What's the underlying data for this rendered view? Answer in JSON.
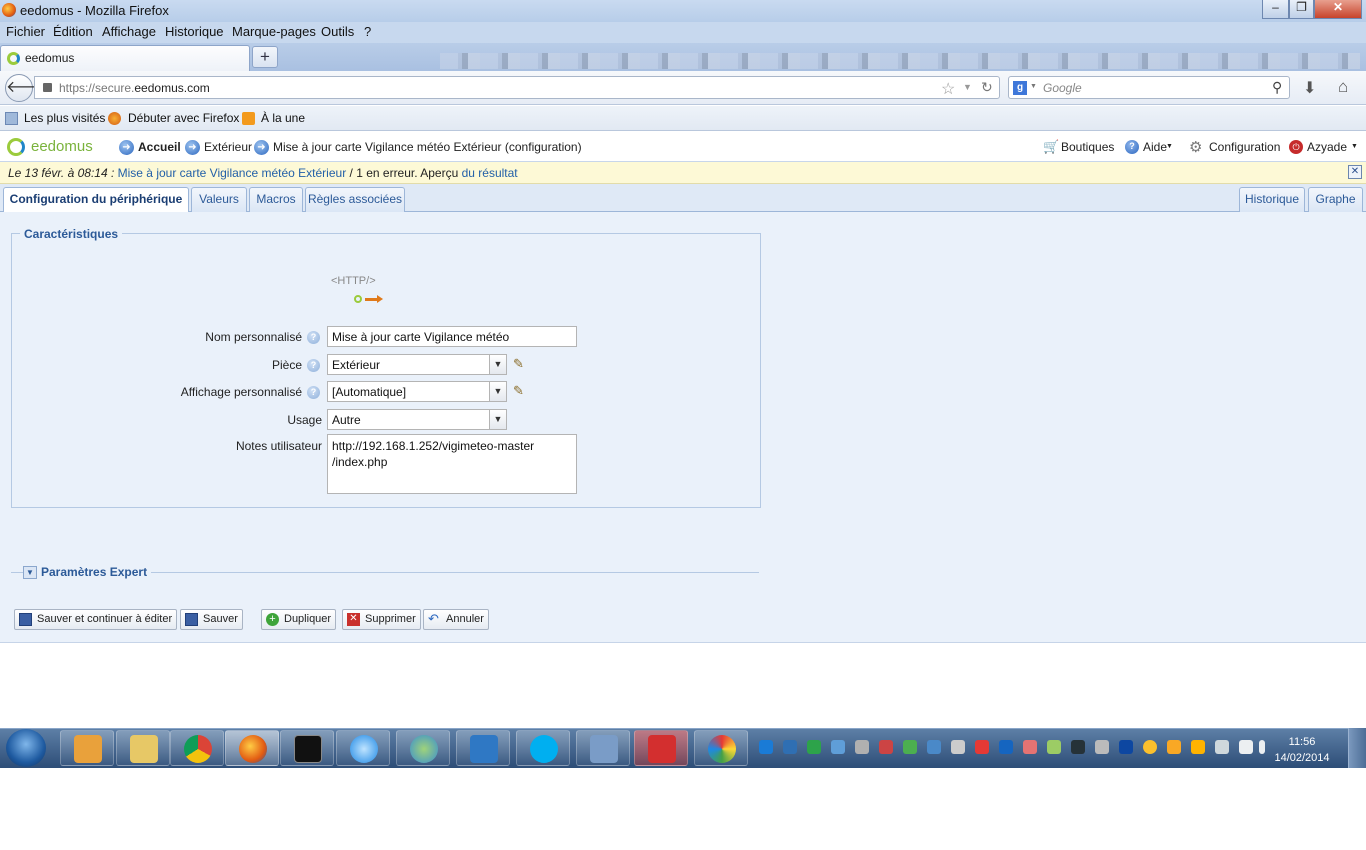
{
  "window": {
    "title": "eedomus - Mozilla Firefox"
  },
  "menubar": [
    "Fichier",
    "Édition",
    "Affichage",
    "Historique",
    "Marque-pages",
    "Outils",
    "?"
  ],
  "browser_tab": {
    "label": "eedomus"
  },
  "url": {
    "prefix": "https://secure.",
    "domain": "eedomus.com"
  },
  "search": {
    "placeholder": "Google",
    "engine_badge": "g"
  },
  "bookmarks": [
    "Les plus visités",
    "Débuter avec Firefox",
    "À la une"
  ],
  "app": {
    "logo": "eedomus",
    "breadcrumb": [
      "Accueil",
      "Extérieur",
      "Mise à jour carte Vigilance météo Extérieur (configuration)"
    ],
    "right_menu": [
      "Boutiques",
      "Aide",
      "Configuration",
      "Azyade"
    ]
  },
  "alert": {
    "date": "Le 13 févr. à 08:14 :",
    "link1": "Mise à jour carte Vigilance météo Extérieur",
    "middle": " / 1 en erreur. Aperçu ",
    "link2": "du résultat"
  },
  "tabs": [
    "Configuration du périphérique",
    "Valeurs",
    "Macros",
    "Règles associées"
  ],
  "tabs_right": [
    "Historique",
    "Graphe"
  ],
  "section": {
    "legend": "Caractéristiques",
    "icon_label": "<HTTP/>",
    "fields": {
      "name": {
        "label": "Nom personnalisé",
        "value": "Mise à jour carte Vigilance météo"
      },
      "room": {
        "label": "Pièce",
        "value": "Extérieur"
      },
      "display": {
        "label": "Affichage personnalisé",
        "value": "[Automatique]"
      },
      "usage": {
        "label": "Usage",
        "value": "Autre"
      },
      "notes": {
        "label": "Notes utilisateur",
        "value": "http://192.168.1.252/vigimeteo-master\n/index.php"
      }
    }
  },
  "expert": {
    "label": "Paramètres Expert"
  },
  "buttons": {
    "save_continue": "Sauver et continuer à éditer",
    "save": "Sauver",
    "duplicate": "Dupliquer",
    "delete": "Supprimer",
    "cancel": "Annuler"
  },
  "taskbar": {
    "apps": [
      "outlook",
      "explorer",
      "chrome",
      "firefox",
      "cmd",
      "internet-explorer",
      "messenger",
      "lync",
      "skype",
      "network",
      "pdf",
      "paint"
    ],
    "time": "11:56",
    "date": "14/02/2014"
  },
  "colors": {
    "accent": "#2c5a98",
    "alert_bg": "#fdf9d6",
    "content_bg": "#eaf1fa",
    "logo_green": "#9bcb3c"
  }
}
